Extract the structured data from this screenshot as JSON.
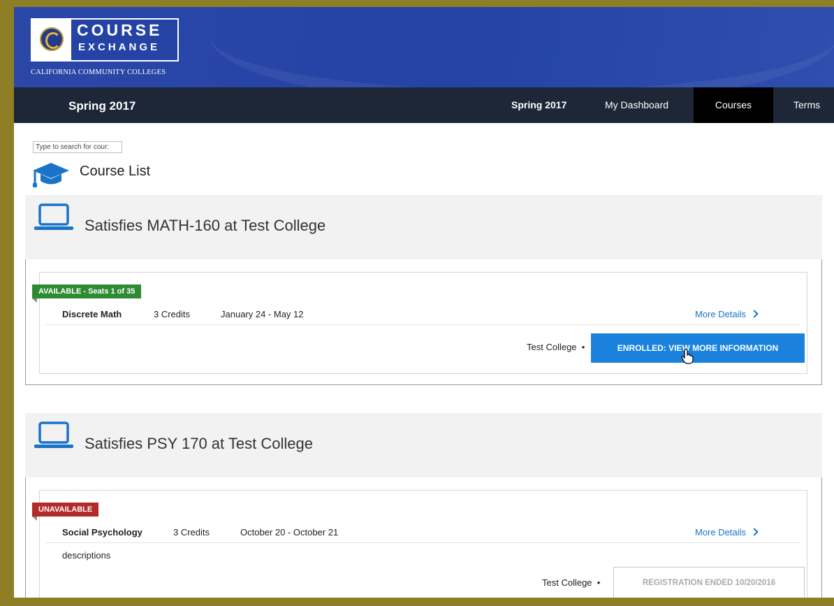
{
  "header": {
    "logo_line1": "COURSE",
    "logo_line2": "EXCHANGE",
    "logo_subtitle": "CALIFORNIA COMMUNITY COLLEGES",
    "brand_color": "#2443a5"
  },
  "nav": {
    "term_title": "Spring 2017",
    "items": [
      "Spring 2017",
      "My Dashboard",
      "Courses",
      "Terms"
    ],
    "active": "Courses",
    "background": "#1d2737"
  },
  "search": {
    "placeholder": "Type to search for cour:"
  },
  "page": {
    "title": "Course List"
  },
  "groups": [
    {
      "title": "Satisfies MATH-160 at Test College",
      "status": "AVAILABLE - Seats 1 of 35",
      "status_color": "#2e8b34",
      "course": "Discrete Math",
      "credits": "3 Credits",
      "dates": "January 24 - May 12",
      "more_link": "More Details",
      "college": "Test College",
      "action": "ENROLLED: VIEW MORE INFORMATION"
    },
    {
      "title": "Satisfies PSY 170 at Test College",
      "status": "UNAVAILABLE",
      "status_color": "#b22a2a",
      "course": "Social Psychology",
      "credits": "3 Credits",
      "dates": "October 20 - October 21",
      "more_link": "More Details",
      "description": "descriptions",
      "college": "Test College",
      "action": "REGISTRATION ENDED 10/20/2016"
    }
  ]
}
